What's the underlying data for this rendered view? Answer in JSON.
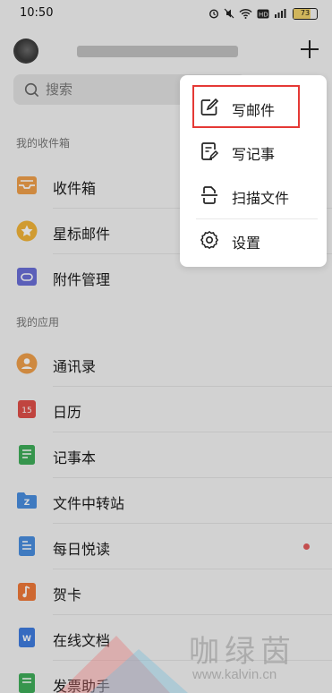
{
  "status_bar": {
    "time": "10:50",
    "battery": "73"
  },
  "header": {
    "add_icon": "plus-icon"
  },
  "search": {
    "placeholder": "搜索"
  },
  "sections": {
    "inbox_title": "我的收件箱",
    "apps_title": "我的应用"
  },
  "inbox_items": [
    {
      "label": "收件箱",
      "icon": "inbox-icon",
      "color": "#f0a04b"
    },
    {
      "label": "星标邮件",
      "icon": "star-icon",
      "color": "#f3b53a"
    },
    {
      "label": "附件管理",
      "icon": "attachment-icon",
      "color": "#6b6fd8"
    }
  ],
  "app_items": [
    {
      "label": "通讯录",
      "icon": "contacts-icon",
      "color": "#f0a04b"
    },
    {
      "label": "日历",
      "icon": "calendar-icon",
      "color": "#e0504a",
      "badge": "15"
    },
    {
      "label": "记事本",
      "icon": "notepad-icon",
      "color": "#3fae5a"
    },
    {
      "label": "文件中转站",
      "icon": "file-transfer-icon",
      "color": "#4a8fe0"
    },
    {
      "label": "每日悦读",
      "icon": "reading-icon",
      "color": "#4a8fe0"
    },
    {
      "label": "贺卡",
      "icon": "greeting-card-icon",
      "color": "#f07a3a"
    },
    {
      "label": "在线文档",
      "icon": "online-doc-icon",
      "color": "#3f7de0"
    },
    {
      "label": "发票助手",
      "icon": "invoice-icon",
      "color": "#3fae5a"
    }
  ],
  "popup_menu": {
    "items": [
      {
        "label": "写邮件",
        "icon": "compose-icon"
      },
      {
        "label": "写记事",
        "icon": "note-icon"
      },
      {
        "label": "扫描文件",
        "icon": "scan-icon"
      },
      {
        "label": "设置",
        "icon": "gear-icon"
      }
    ]
  },
  "watermark": {
    "text": "咖绿茵",
    "url": "www.kalvin.cn"
  },
  "colors": {
    "highlight": "#e53935",
    "unread_dot": "#e45b5b"
  }
}
